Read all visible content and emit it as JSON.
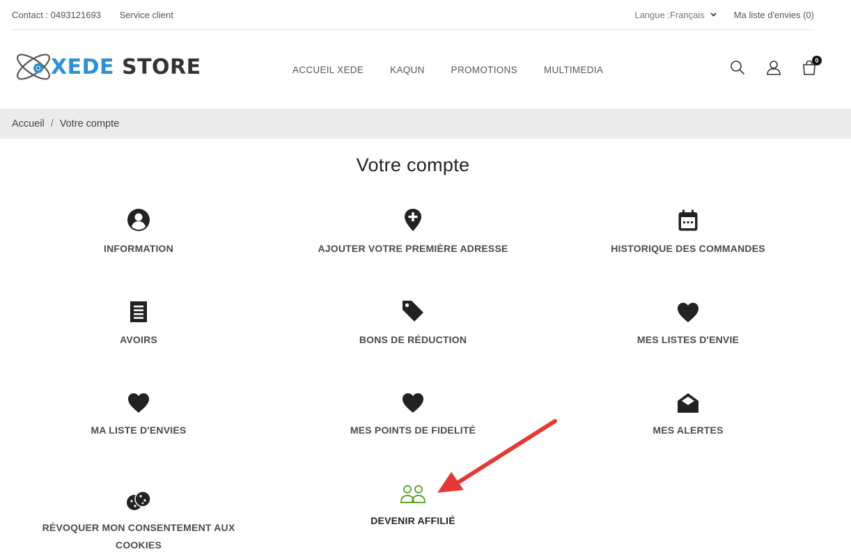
{
  "topbar": {
    "contact": "Contact : 0493121693",
    "service": "Service client",
    "language": "Langue :Français",
    "wishlist": "Ma liste d'envies (0)"
  },
  "logo": {
    "part1": "XEDE",
    "part2": " STORE"
  },
  "nav": [
    "ACCUEIL XEDE",
    "KAQUN",
    "PROMOTIONS",
    "MULTIMEDIA"
  ],
  "cart_count": "0",
  "breadcrumb": {
    "home": "Accueil",
    "separator": "/",
    "current": "Votre compte"
  },
  "page_title": "Votre compte",
  "tiles": [
    {
      "label": "INFORMATION",
      "icon": "user-circle-icon"
    },
    {
      "label": "AJOUTER VOTRE PREMIÈRE ADRESSE",
      "icon": "map-marker-plus-icon"
    },
    {
      "label": "HISTORIQUE DES COMMANDES",
      "icon": "calendar-icon"
    },
    {
      "label": "AVOIRS",
      "icon": "receipt-icon"
    },
    {
      "label": "BONS DE RÉDUCTION",
      "icon": "tag-icon"
    },
    {
      "label": "MES LISTES D'ENVIE",
      "icon": "heart-icon"
    },
    {
      "label": "MA LISTE D'ENVIES",
      "icon": "heart-icon"
    },
    {
      "label": "MES POINTS DE FIDELITÉ",
      "icon": "heart-icon"
    },
    {
      "label": "MES ALERTES",
      "icon": "envelope-open-icon"
    },
    {
      "label": "RÉVOQUER MON CONSENTEMENT AUX COOKIES",
      "icon": "cookie-icon"
    },
    {
      "label": "DEVENIR AFFILIÉ",
      "icon": "users-icon"
    }
  ],
  "colors": {
    "accent_blue": "#2d8fd5",
    "affiliate_green": "#5fa630",
    "arrow_red": "#e53935"
  }
}
